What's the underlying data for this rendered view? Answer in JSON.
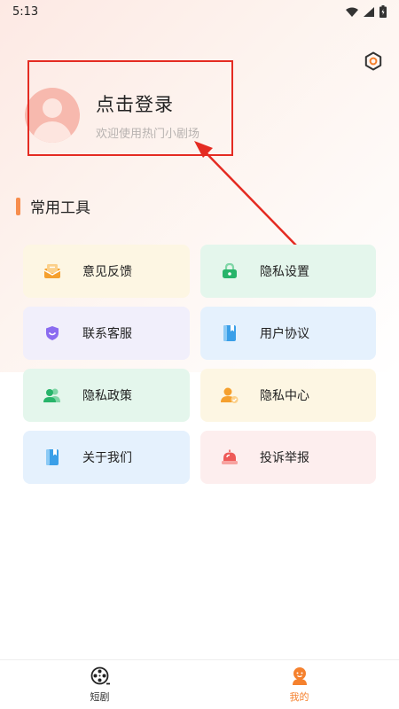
{
  "status_bar": {
    "time": "5:13"
  },
  "profile": {
    "login_label": "点击登录",
    "welcome_text": "欢迎使用热门小剧场"
  },
  "section": {
    "title": "常用工具"
  },
  "tools": [
    {
      "label": "意见反馈",
      "icon": "feedback-icon",
      "bg": "#fdf6e3",
      "color": "#f5a02e"
    },
    {
      "label": "隐私设置",
      "icon": "lock-icon",
      "bg": "#e4f6ec",
      "color": "#27b46a"
    },
    {
      "label": "联系客服",
      "icon": "service-shield-icon",
      "bg": "#f1effb",
      "color": "#8b6cf0"
    },
    {
      "label": "用户协议",
      "icon": "agreement-book-icon",
      "bg": "#e5f1fd",
      "color": "#3a9fe8"
    },
    {
      "label": "隐私政策",
      "icon": "policy-people-icon",
      "bg": "#e4f6ec",
      "color": "#27b46a"
    },
    {
      "label": "隐私中心",
      "icon": "privacy-user-icon",
      "bg": "#fdf6e3",
      "color": "#f5a02e"
    },
    {
      "label": "关于我们",
      "icon": "about-book-icon",
      "bg": "#e5f1fd",
      "color": "#3a9fe8"
    },
    {
      "label": "投诉举报",
      "icon": "report-alarm-icon",
      "bg": "#fdeeee",
      "color": "#ee5a58"
    }
  ],
  "bottom_nav": [
    {
      "label": "短剧",
      "icon": "film-reel-icon",
      "active": false
    },
    {
      "label": "我的",
      "icon": "profile-face-icon",
      "active": true
    }
  ],
  "colors": {
    "accent": "#f78d4d",
    "annotation": "#e42b22",
    "active_tab": "#f5812e"
  }
}
